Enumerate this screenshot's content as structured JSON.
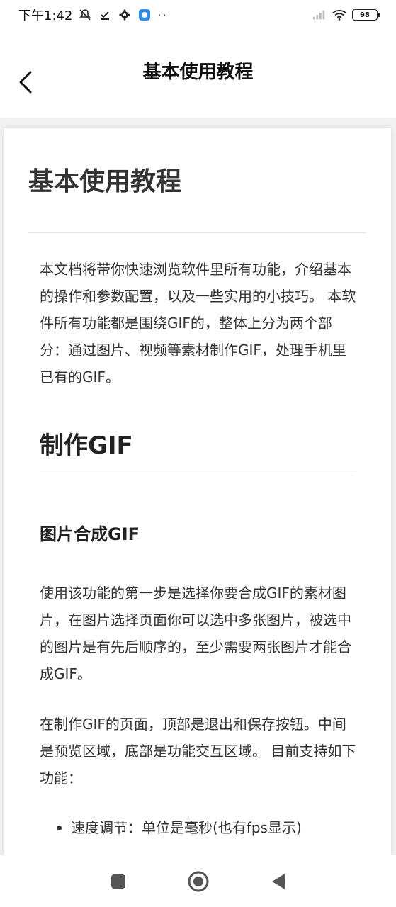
{
  "status_bar": {
    "time": "下午1:42",
    "battery": "98"
  },
  "header": {
    "title": "基本使用教程"
  },
  "document": {
    "title": "基本使用教程",
    "intro": "本文档将带你快速浏览软件里所有功能，介绍基本的操作和参数配置，以及一些实用的小技巧。 本软件所有功能都是围绕GIF的，整体上分为两个部分：通过图片、视频等素材制作GIF，处理手机里已有的GIF。",
    "section_title": "制作GIF",
    "subsection_title": "图片合成GIF",
    "para_select": "使用该功能的第一步是选择你要合成GIF的素材图片，在图片选择页面你可以选中多张图片，被选中的图片是有先后顺序的，至少需要两张图片才能合成GIF。",
    "para_layout": "在制作GIF的页面，顶部是退出和保存按钮。中间是预览区域，底部是功能交互区域。 目前支持如下功能：",
    "features": [
      "速度调节：单位是毫秒(也有fps显示)"
    ]
  },
  "icons": {
    "back": "back-arrow-icon",
    "nav_recent": "square-icon",
    "nav_home": "circle-icon",
    "nav_back": "triangle-back-icon"
  }
}
